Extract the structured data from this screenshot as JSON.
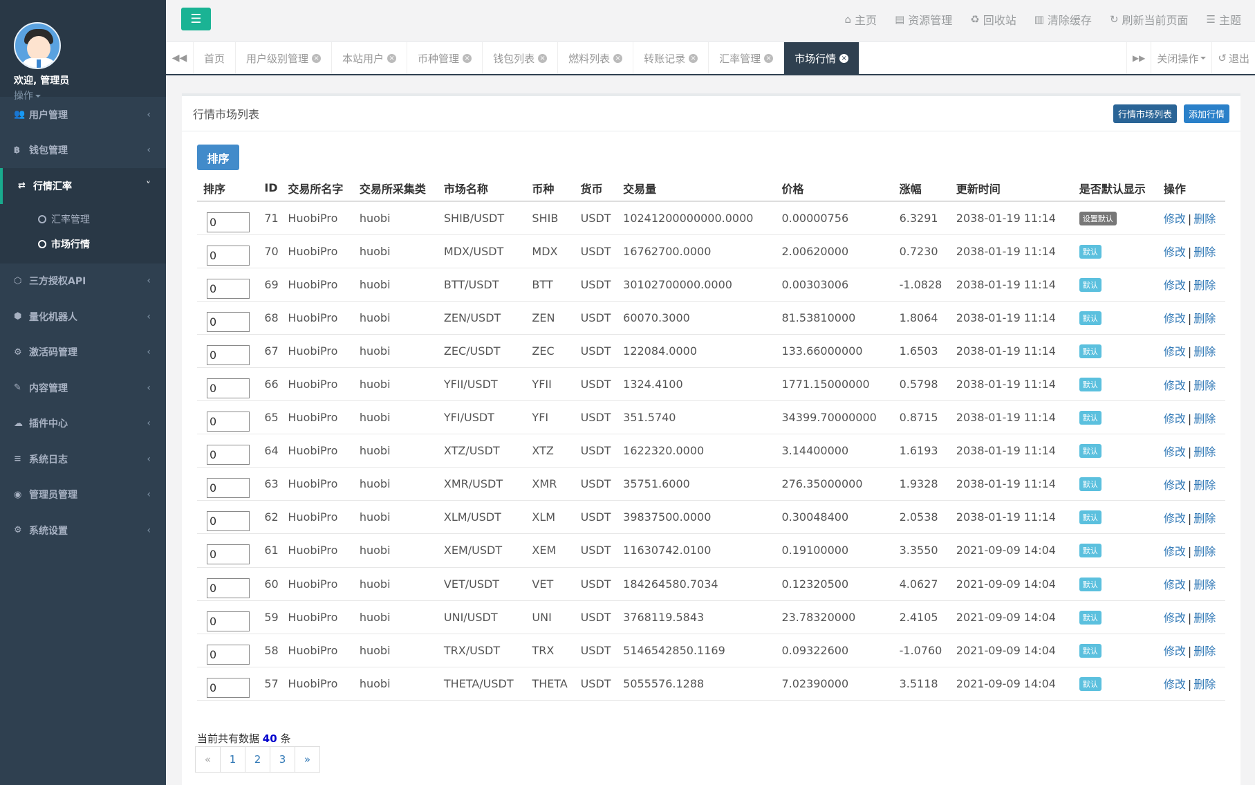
{
  "sidebar": {
    "welcome": "欢迎, 管理员",
    "profile_op": "操作",
    "menu": [
      {
        "label": "用户管理",
        "icon": "users-icon"
      },
      {
        "label": "钱包管理",
        "icon": "bitcoin-icon"
      },
      {
        "label": "行情汇率",
        "icon": "exchange-icon"
      },
      {
        "label": "三方授权API",
        "icon": "cube-icon"
      },
      {
        "label": "量化机器人",
        "icon": "bug-icon"
      },
      {
        "label": "激活码管理",
        "icon": "gear-icon"
      },
      {
        "label": "内容管理",
        "icon": "edit-icon"
      },
      {
        "label": "插件中心",
        "icon": "cloud-icon"
      },
      {
        "label": "系统日志",
        "icon": "database-icon"
      },
      {
        "label": "管理员管理",
        "icon": "user-circle-icon"
      },
      {
        "label": "系统设置",
        "icon": "gears-icon"
      }
    ],
    "submenu": [
      {
        "label": "汇率管理"
      },
      {
        "label": "市场行情"
      }
    ]
  },
  "topbar": {
    "links": [
      {
        "label": "主页",
        "icon": "home-icon"
      },
      {
        "label": "资源管理",
        "icon": "file-icon"
      },
      {
        "label": "回收站",
        "icon": "recycle-icon"
      },
      {
        "label": "清除缓存",
        "icon": "trash-icon"
      },
      {
        "label": "刷新当前页面",
        "icon": "refresh-icon"
      },
      {
        "label": "主题",
        "icon": "list-icon"
      }
    ]
  },
  "tabs": {
    "items": [
      "首页",
      "用户级别管理",
      "本站用户",
      "币种管理",
      "钱包列表",
      "燃料列表",
      "转账记录",
      "汇率管理",
      "市场行情"
    ],
    "close_ops": "关闭操作",
    "logout": "退出"
  },
  "panel": {
    "title": "行情市场列表",
    "btn_list": "行情市场列表",
    "btn_add": "添加行情",
    "sort_btn": "排序",
    "columns": [
      "排序",
      "ID",
      "交易所名字",
      "交易所采集类",
      "市场名称",
      "币种",
      "货币",
      "交易量",
      "价格",
      "涨幅",
      "更新时间",
      "是否默认显示",
      "操作"
    ],
    "edit_label": "修改",
    "delete_label": "删除",
    "sep": "|",
    "rows": [
      {
        "sort": "0",
        "id": "71",
        "exchange": "HuobiPro",
        "collector": "huobi",
        "market": "SHIB/USDT",
        "coin": "SHIB",
        "currency": "USDT",
        "volume": "10241200000000.0000",
        "price": "0.00000756",
        "change": "6.3291",
        "updated": "2038-01-19 11:14",
        "default": "设置默认",
        "is_default": false
      },
      {
        "sort": "0",
        "id": "70",
        "exchange": "HuobiPro",
        "collector": "huobi",
        "market": "MDX/USDT",
        "coin": "MDX",
        "currency": "USDT",
        "volume": "16762700.0000",
        "price": "2.00620000",
        "change": "0.7230",
        "updated": "2038-01-19 11:14",
        "default": "默认",
        "is_default": true
      },
      {
        "sort": "0",
        "id": "69",
        "exchange": "HuobiPro",
        "collector": "huobi",
        "market": "BTT/USDT",
        "coin": "BTT",
        "currency": "USDT",
        "volume": "30102700000.0000",
        "price": "0.00303006",
        "change": "-1.0828",
        "updated": "2038-01-19 11:14",
        "default": "默认",
        "is_default": true
      },
      {
        "sort": "0",
        "id": "68",
        "exchange": "HuobiPro",
        "collector": "huobi",
        "market": "ZEN/USDT",
        "coin": "ZEN",
        "currency": "USDT",
        "volume": "60070.3000",
        "price": "81.53810000",
        "change": "1.8064",
        "updated": "2038-01-19 11:14",
        "default": "默认",
        "is_default": true
      },
      {
        "sort": "0",
        "id": "67",
        "exchange": "HuobiPro",
        "collector": "huobi",
        "market": "ZEC/USDT",
        "coin": "ZEC",
        "currency": "USDT",
        "volume": "122084.0000",
        "price": "133.66000000",
        "change": "1.6503",
        "updated": "2038-01-19 11:14",
        "default": "默认",
        "is_default": true
      },
      {
        "sort": "0",
        "id": "66",
        "exchange": "HuobiPro",
        "collector": "huobi",
        "market": "YFII/USDT",
        "coin": "YFII",
        "currency": "USDT",
        "volume": "1324.4100",
        "price": "1771.15000000",
        "change": "0.5798",
        "updated": "2038-01-19 11:14",
        "default": "默认",
        "is_default": true
      },
      {
        "sort": "0",
        "id": "65",
        "exchange": "HuobiPro",
        "collector": "huobi",
        "market": "YFI/USDT",
        "coin": "YFI",
        "currency": "USDT",
        "volume": "351.5740",
        "price": "34399.70000000",
        "change": "0.8715",
        "updated": "2038-01-19 11:14",
        "default": "默认",
        "is_default": true
      },
      {
        "sort": "0",
        "id": "64",
        "exchange": "HuobiPro",
        "collector": "huobi",
        "market": "XTZ/USDT",
        "coin": "XTZ",
        "currency": "USDT",
        "volume": "1622320.0000",
        "price": "3.14400000",
        "change": "1.6193",
        "updated": "2038-01-19 11:14",
        "default": "默认",
        "is_default": true
      },
      {
        "sort": "0",
        "id": "63",
        "exchange": "HuobiPro",
        "collector": "huobi",
        "market": "XMR/USDT",
        "coin": "XMR",
        "currency": "USDT",
        "volume": "35751.6000",
        "price": "276.35000000",
        "change": "1.9328",
        "updated": "2038-01-19 11:14",
        "default": "默认",
        "is_default": true
      },
      {
        "sort": "0",
        "id": "62",
        "exchange": "HuobiPro",
        "collector": "huobi",
        "market": "XLM/USDT",
        "coin": "XLM",
        "currency": "USDT",
        "volume": "39837500.0000",
        "price": "0.30048400",
        "change": "2.0538",
        "updated": "2038-01-19 11:14",
        "default": "默认",
        "is_default": true
      },
      {
        "sort": "0",
        "id": "61",
        "exchange": "HuobiPro",
        "collector": "huobi",
        "market": "XEM/USDT",
        "coin": "XEM",
        "currency": "USDT",
        "volume": "11630742.0100",
        "price": "0.19100000",
        "change": "3.3550",
        "updated": "2021-09-09 14:04",
        "default": "默认",
        "is_default": true
      },
      {
        "sort": "0",
        "id": "60",
        "exchange": "HuobiPro",
        "collector": "huobi",
        "market": "VET/USDT",
        "coin": "VET",
        "currency": "USDT",
        "volume": "184264580.7034",
        "price": "0.12320500",
        "change": "4.0627",
        "updated": "2021-09-09 14:04",
        "default": "默认",
        "is_default": true
      },
      {
        "sort": "0",
        "id": "59",
        "exchange": "HuobiPro",
        "collector": "huobi",
        "market": "UNI/USDT",
        "coin": "UNI",
        "currency": "USDT",
        "volume": "3768119.5843",
        "price": "23.78320000",
        "change": "2.4105",
        "updated": "2021-09-09 14:04",
        "default": "默认",
        "is_default": true
      },
      {
        "sort": "0",
        "id": "58",
        "exchange": "HuobiPro",
        "collector": "huobi",
        "market": "TRX/USDT",
        "coin": "TRX",
        "currency": "USDT",
        "volume": "5146542850.1169",
        "price": "0.09322600",
        "change": "-1.0760",
        "updated": "2021-09-09 14:04",
        "default": "默认",
        "is_default": true
      },
      {
        "sort": "0",
        "id": "57",
        "exchange": "HuobiPro",
        "collector": "huobi",
        "market": "THETA/USDT",
        "coin": "THETA",
        "currency": "USDT",
        "volume": "5055576.1288",
        "price": "7.02390000",
        "change": "3.5118",
        "updated": "2021-09-09 14:04",
        "default": "默认",
        "is_default": true
      }
    ],
    "count_prefix": "当前共有数据",
    "count": "40",
    "count_suffix": "条",
    "pages": [
      "«",
      "1",
      "2",
      "3",
      "»"
    ]
  },
  "colors": {
    "sidebar_bg": "#2f4050",
    "accent": "#1ab394",
    "primary": "#428bca",
    "badge_default": "#5bc0de",
    "badge_set": "#777777"
  }
}
